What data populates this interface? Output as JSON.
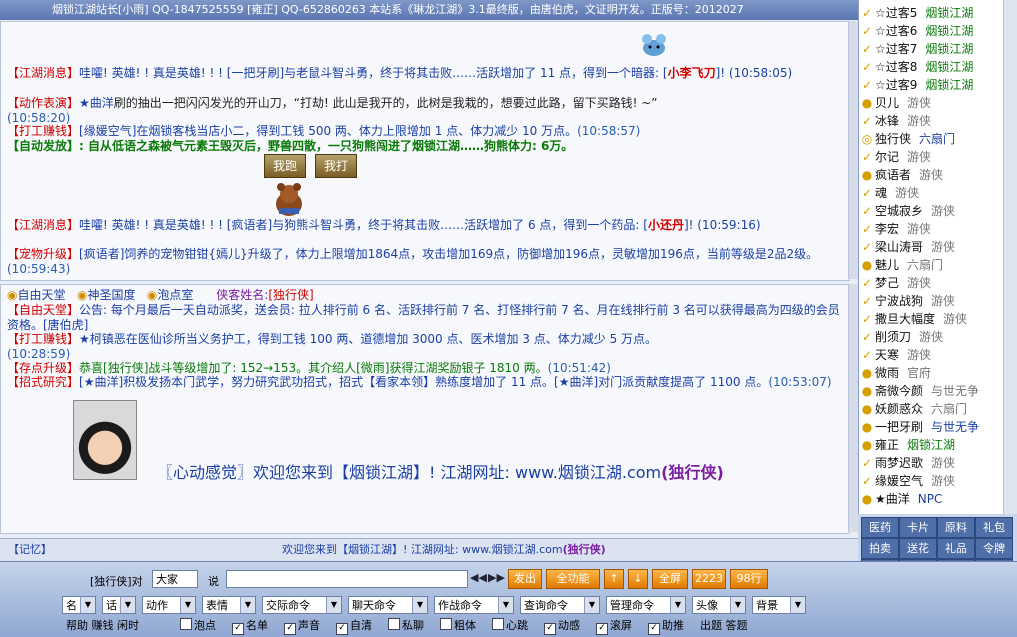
{
  "topbar": "烟锁江湖站长[小雨] QQ-1847525559 [雍正] QQ-652860263   本站系《琳龙江湖》3.1最终版，由唐伯虎，文证明开发。正版号：2012027",
  "chat_top": {
    "l1_tag": "【江湖消息】",
    "l1_text": "哇嚯! 英雄! ! 真是英雄! ! ! [一把牙刷]与老鼠斗智斗勇，终于将其击败……活跃增加了 11 点，得到一个暗器: [",
    "l1_item": "小李飞刀",
    "l1_end": "]! (10:58:05)",
    "l2_tag": "【动作表演】",
    "l2_name": "★曲洋",
    "l2_text": "刷的抽出一把闪闪发光的开山刀，“打劫! 此山是我开的，此树是我栽的，想要过此路，留下买路钱! ~”",
    "l2_time": "(10:58:20)",
    "l3_tag": "【打工赚钱】",
    "l3_name": "[缘媛空气]",
    "l3_text": "在烟锁客栈当店小二，得到工钱 500 两、体力上限增加 1 点、体力减少 10 万点。",
    "l3_time": "(10:58:57)",
    "l4": "【自动发放】: 自从低语之森被气元素王毁灭后，野兽四散，一只狗熊闯进了烟锁江湖……狗熊体力: 6万。",
    "btn_run": "我跑",
    "btn_fight": "我打",
    "l5_tag": "【江湖消息】",
    "l5_text": "哇嚯! 英雄! ! 真是英雄! ! ! [疯语者]与狗熊斗智斗勇，终于将其击败……活跃增加了 6 点，得到一个药品: [",
    "l5_item": "小还丹",
    "l5_end": "]! (10:59:16)",
    "l6_tag": "【宠物升级】",
    "l6_text": "[疯语者]饲养的宠物钳钳{嫣儿}升级了，体力上限增加1864点，攻击增加169点，防御增加196点，灵敏增加196点，当前等级是2品2级。",
    "l6_time": "(10:59:43)"
  },
  "chat_bottom": {
    "tab1": "自由天堂",
    "tab2": "神圣国度",
    "tab3": "泡点室",
    "guest_label": "侠客姓名:",
    "guest_name": "[独行侠]",
    "b1_tag": "【自由天堂】",
    "b1_text": "公告: 每个月最后一天自动派奖，送会员: 拉人排行前 6 名、活跃排行前 7 名、打怪排行前 7 名、月在线排行前 3 名可以获得最高为四级的会员资格。[唐伯虎]",
    "b2_tag": "【打工赚钱】",
    "b2_name": "★柯镇恶",
    "b2_text": "在医仙诊所当义务护工，得到工钱 100 两、道德增加 3000 点、医术增加 3 点、体力减少 5 万点。",
    "b2_time": "(10:28:59)",
    "b3_tag": "【存点升级】",
    "b3_text": "恭喜[独行侠]战斗等级增加了: 152→153。其介绍人[微雨]获得江湖奖励银子 1810 两。",
    "b3_time": "(10:51:42)",
    "b4_tag": "【招式研究】",
    "b4_text": "[★曲洋]积极发扬本门武学，努力研究武功招式，招式【看家本领】熟练度增加了 11 点。[★曲洋]对门派贡献度提高了 1100 点。",
    "b4_time": "(10:53:07)",
    "welcome": "〖心动感觉〗欢迎您来到【烟锁江湖】! 江湖网址: www.烟锁江湖.com",
    "welcome_user": "(独行侠)"
  },
  "users": [
    {
      "name": "☆过客5",
      "sect": "烟锁江湖",
      "cls": "green",
      "icon": "✓"
    },
    {
      "name": "☆过客6",
      "sect": "烟锁江湖",
      "cls": "green",
      "icon": "✓"
    },
    {
      "name": "☆过客7",
      "sect": "烟锁江湖",
      "cls": "green",
      "icon": "✓"
    },
    {
      "name": "☆过客8",
      "sect": "烟锁江湖",
      "cls": "green",
      "icon": "✓"
    },
    {
      "name": "☆过客9",
      "sect": "烟锁江湖",
      "cls": "green",
      "icon": "✓"
    },
    {
      "name": "贝儿",
      "sect": "游侠",
      "cls": "",
      "icon": "●"
    },
    {
      "name": "冰锋",
      "sect": "游侠",
      "cls": "",
      "icon": "✓"
    },
    {
      "name": "独行侠",
      "sect": "六扇门",
      "cls": "blue",
      "icon": "◎"
    },
    {
      "name": "尔记",
      "sect": "游侠",
      "cls": "",
      "icon": "✓"
    },
    {
      "name": "疯语者",
      "sect": "游侠",
      "cls": "",
      "icon": "●"
    },
    {
      "name": "魂",
      "sect": "游侠",
      "cls": "",
      "icon": "✓"
    },
    {
      "name": "空城寂乡",
      "sect": "游侠",
      "cls": "",
      "icon": "✓"
    },
    {
      "name": "李宏",
      "sect": "游侠",
      "cls": "",
      "icon": "✓"
    },
    {
      "name": "梁山涛哥",
      "sect": "游侠",
      "cls": "",
      "icon": "✓"
    },
    {
      "name": "魅儿",
      "sect": "六扇门",
      "cls": "",
      "icon": "●"
    },
    {
      "name": "梦己",
      "sect": "游侠",
      "cls": "",
      "icon": "✓"
    },
    {
      "name": "宁波战狗",
      "sect": "游侠",
      "cls": "",
      "icon": "✓"
    },
    {
      "name": "撒旦大幅度",
      "sect": "游侠",
      "cls": "",
      "icon": "✓"
    },
    {
      "name": "削须刀",
      "sect": "游侠",
      "cls": "",
      "icon": "✓"
    },
    {
      "name": "天寒",
      "sect": "游侠",
      "cls": "",
      "icon": "✓"
    },
    {
      "name": "微雨",
      "sect": "官府",
      "cls": "",
      "icon": "●"
    },
    {
      "name": "斋微今颜",
      "sect": "与世无争",
      "cls": "",
      "icon": "●"
    },
    {
      "name": "妖颜惑众",
      "sect": "六扇门",
      "cls": "",
      "icon": "●"
    },
    {
      "name": "一把牙刷",
      "sect": "与世无争",
      "cls": "blue",
      "icon": "●"
    },
    {
      "name": "雍正",
      "sect": "烟锁江湖",
      "cls": "green",
      "icon": "●"
    },
    {
      "name": "雨梦迟歌",
      "sect": "游侠",
      "cls": "",
      "icon": "✓"
    },
    {
      "name": "缘媛空气",
      "sect": "游侠",
      "cls": "",
      "icon": "✓"
    },
    {
      "name": "★曲洋",
      "sect": "NPC",
      "cls": "blue",
      "icon": "●"
    }
  ],
  "rbuttons_small": [
    "医药",
    "卡片",
    "原料",
    "礼包",
    "拍卖",
    "送花",
    "礼品",
    "令牌",
    "会员",
    "领奖",
    "清屏",
    "贴图"
  ],
  "rbuttons_big": [
    "存点",
    "名单",
    "房间",
    "状态",
    "物品",
    "作战",
    "寄信",
    "离开"
  ],
  "status_left": "【记忆】",
  "status_center": "欢迎您来到【烟锁江湖】! 江湖网址: www.烟锁江湖.com",
  "status_user": "(独行侠)",
  "bottom": {
    "speaker": "[独行侠]对",
    "target": "大家",
    "say": "说",
    "send": "发出",
    "all_func": "全功能",
    "fullscreen": "全屏",
    "num1": "2223",
    "num2": "98行",
    "selects": [
      "名",
      "话",
      "动作",
      "表情",
      "交际命令",
      "聊天命令",
      "作战命令",
      "查询命令",
      "管理命令",
      "头像",
      "背景"
    ],
    "checks": [
      {
        "label": "泡点",
        "on": false
      },
      {
        "label": "名单",
        "on": true
      },
      {
        "label": "声音",
        "on": true
      },
      {
        "label": "自清",
        "on": true
      },
      {
        "label": "私聊",
        "on": false
      },
      {
        "label": "粗体",
        "on": false
      },
      {
        "label": "心跳",
        "on": false
      },
      {
        "label": "动感",
        "on": true
      },
      {
        "label": "滚屏",
        "on": true
      },
      {
        "label": "助推",
        "on": true
      }
    ],
    "help": "帮助 赚钱 闲时",
    "tail": "出题 答题"
  }
}
